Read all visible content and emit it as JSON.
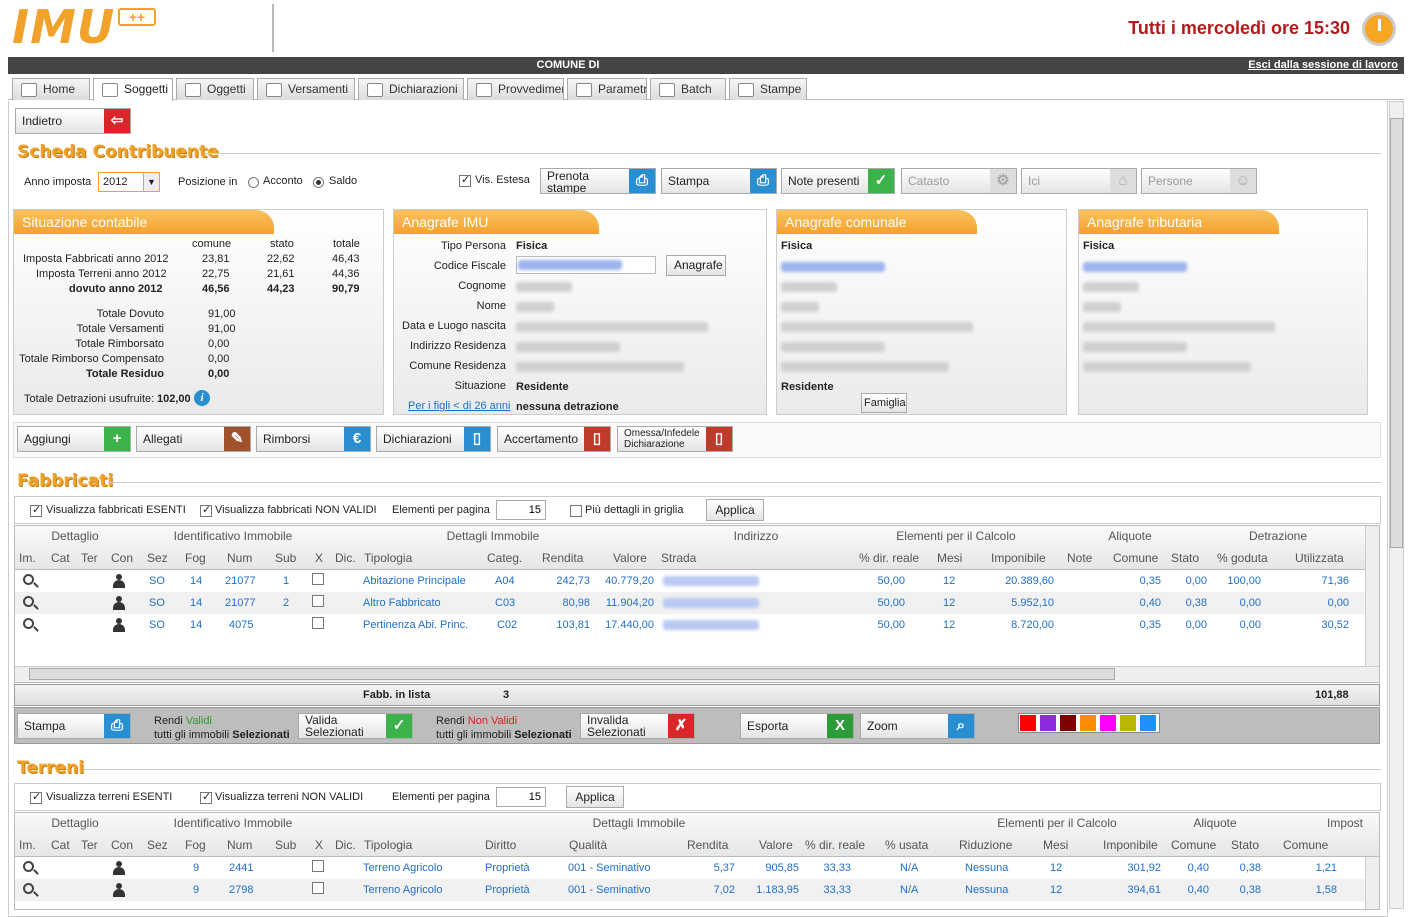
{
  "header": {
    "logo": "IMU",
    "logo_plus": "++",
    "schedule": "Tutti i mercoledì ore 15:30"
  },
  "bar": {
    "title": "COMUNE DI",
    "logout": "Esci dalla sessione di lavoro"
  },
  "tabs": [
    {
      "label": "Home"
    },
    {
      "label": "Soggetti"
    },
    {
      "label": "Oggetti"
    },
    {
      "label": "Versamenti"
    },
    {
      "label": "Dichiarazioni"
    },
    {
      "label": "Provvedimenti"
    },
    {
      "label": "Parametri"
    },
    {
      "label": "Batch"
    },
    {
      "label": "Stampe"
    }
  ],
  "back_label": "Indietro",
  "page_title": "Scheda Contribuente",
  "filters": {
    "anno_label": "Anno imposta",
    "anno_value": "2012",
    "posizione_label": "Posizione in",
    "acconto": "Acconto",
    "saldo": "Saldo",
    "vis_estesa": "Vis. Estesa"
  },
  "actions": {
    "prenota": "Prenota stampe",
    "stampa": "Stampa",
    "note": "Note presenti",
    "catasto": "Catasto",
    "ici": "Ici",
    "persone": "Persone"
  },
  "situazione": {
    "title": "Situazione contabile",
    "cols": [
      "comune",
      "stato",
      "totale"
    ],
    "rows": [
      {
        "label": "Imposta Fabbricati anno 2012",
        "v": [
          "23,81",
          "22,62",
          "46,43"
        ]
      },
      {
        "label": "Imposta Terreni anno 2012",
        "v": [
          "22,75",
          "21,61",
          "44,36"
        ]
      },
      {
        "label": "dovuto anno 2012",
        "v": [
          "46,56",
          "44,23",
          "90,79"
        ]
      }
    ],
    "totals": [
      {
        "label": "Totale Dovuto",
        "v": "91,00"
      },
      {
        "label": "Totale Versamenti",
        "v": "91,00"
      },
      {
        "label": "Totale Rimborsato",
        "v": "0,00"
      },
      {
        "label": "Totale Rimborso Compensato",
        "v": "0,00"
      },
      {
        "label": "Totale Residuo",
        "v": "0,00"
      }
    ],
    "detrazioni_label": "Totale Detrazioni usufruite:",
    "detrazioni_value": "102,00"
  },
  "anagrafe_imu": {
    "title": "Anagrafe IMU",
    "labels": [
      "Tipo Persona",
      "Codice Fiscale",
      "Cognome",
      "Nome",
      "Data e Luogo nascita",
      "Indirizzo Residenza",
      "Comune Residenza",
      "Situazione"
    ],
    "tipo": "Fisica",
    "situazione": "Residente",
    "figli_label": "Per i figli < di 26 anni",
    "figli_value": "nessuna detrazione",
    "btn": "Anagrafe"
  },
  "anagrafe_comunale": {
    "title": "Anagrafe comunale",
    "tipo": "Fisica",
    "situazione": "Residente",
    "btn": "Famiglia"
  },
  "anagrafe_tributaria": {
    "title": "Anagrafe tributaria",
    "tipo": "Fisica"
  },
  "row_actions": {
    "aggiungi": "Aggiungi",
    "allegati": "Allegati",
    "rimborsi": "Rimborsi",
    "dichiarazioni": "Dichiarazioni",
    "accertamento": "Accertamento",
    "omessa1": "Omessa/Infedele",
    "omessa2": "Dichiarazione"
  },
  "fabbricati": {
    "title": "Fabbricati",
    "chk_esenti": "Visualizza fabbricati ESENTI",
    "chk_nonvalidi": "Visualizza fabbricati NON VALIDI",
    "per_pagina": "Elementi per pagina",
    "per_pagina_val": "15",
    "piu_dettagli": "Più dettagli in griglia",
    "applica": "Applica",
    "groups": [
      "Dettaglio",
      "Identificativo Immobile",
      "Dettagli Immobile",
      "Indirizzo",
      "Elementi per il Calcolo",
      "Aliquote",
      "Detrazione"
    ],
    "cols": [
      "Im.",
      "Cat",
      "Ter",
      "Con",
      "Sez",
      "Fog",
      "Num",
      "Sub",
      "X",
      "Dic.",
      "Tipologia",
      "Categ.",
      "Rendita",
      "Valore",
      "Strada",
      "% dir. reale",
      "Mesi",
      "Imponibile",
      "Note",
      "Comune",
      "Stato",
      "% goduta",
      "Utilizzata"
    ],
    "rows": [
      {
        "sez": "SO",
        "fog": "14",
        "num": "21077",
        "sub": "1",
        "tip": "Abitazione Principale",
        "cat": "A04",
        "rend": "242,73",
        "val": "40.779,20",
        "dir": "50,00",
        "mesi": "12",
        "imp": "20.389,60",
        "com": "0,35",
        "sta": "0,00",
        "god": "100,00",
        "uti": "71,36"
      },
      {
        "sez": "SO",
        "fog": "14",
        "num": "21077",
        "sub": "2",
        "tip": "Altro Fabbricato",
        "cat": "C03",
        "rend": "80,98",
        "val": "11.904,20",
        "dir": "50,00",
        "mesi": "12",
        "imp": "5.952,10",
        "com": "0,40",
        "sta": "0,38",
        "god": "0,00",
        "uti": "0,00"
      },
      {
        "sez": "SO",
        "fog": "14",
        "num": "4075",
        "sub": "",
        "tip": "Pertinenza Abi. Princ.",
        "cat": "C02",
        "rend": "103,81",
        "val": "17.440,00",
        "dir": "50,00",
        "mesi": "12",
        "imp": "8.720,00",
        "com": "0,35",
        "sta": "0,00",
        "god": "0,00",
        "uti": "30,52"
      }
    ],
    "footer_label": "Fabb. in lista",
    "footer_count": "3",
    "footer_total": "101,88",
    "tb": {
      "stampa": "Stampa",
      "rendi_validi_1": "Rendi ",
      "rendi_validi_2": "Validi",
      "rendi_validi_3": "tutti gli immobili ",
      "sel": "Selezionati",
      "valida": "Valida Selezionati",
      "rendi_nv_2": "Non Validi",
      "invalida": "Invalida Selezionati",
      "esporta": "Esporta",
      "zoom": "Zoom"
    },
    "swatches": [
      "#ff0000",
      "#8a2be2",
      "#800000",
      "#ff8c00",
      "#ff00ff",
      "#b8b800",
      "#1e90ff"
    ]
  },
  "terreni": {
    "title": "Terreni",
    "chk_esenti": "Visualizza terreni ESENTI",
    "chk_nonvalidi": "Visualizza terreni NON VALIDI",
    "per_pagina": "Elementi per pagina",
    "per_pagina_val": "15",
    "applica": "Applica",
    "groups": [
      "Dettaglio",
      "Identificativo Immobile",
      "Dettagli Immobile",
      "Elementi per il Calcolo",
      "Aliquote",
      "Impost"
    ],
    "cols": [
      "Im.",
      "Cat",
      "Ter",
      "Con",
      "Sez",
      "Fog",
      "Num",
      "Sub",
      "X",
      "Dic.",
      "Tipologia",
      "Diritto",
      "Qualità",
      "Rendita",
      "Valore",
      "% dir. reale",
      "% usata",
      "Riduzione",
      "Mesi",
      "Imponibile",
      "Comune",
      "Stato",
      "Comune"
    ],
    "rows": [
      {
        "fog": "9",
        "num": "2441",
        "tip": "Terreno Agricolo",
        "dir": "Proprietà",
        "qual": "001 - Seminativo",
        "rend": "5,37",
        "val": "905,85",
        "dirr": "33,33",
        "usata": "N/A",
        "rid": "Nessuna",
        "mesi": "12",
        "imp": "301,92",
        "com": "0,40",
        "sta": "0,38",
        "imc": "1,21"
      },
      {
        "fog": "9",
        "num": "2798",
        "tip": "Terreno Agricolo",
        "dir": "Proprietà",
        "qual": "001 - Seminativo",
        "rend": "7,02",
        "val": "1.183,95",
        "dirr": "33,33",
        "usata": "N/A",
        "rid": "Nessuna",
        "mesi": "12",
        "imp": "394,61",
        "com": "0,40",
        "sta": "0,38",
        "imc": "1,58"
      }
    ]
  }
}
